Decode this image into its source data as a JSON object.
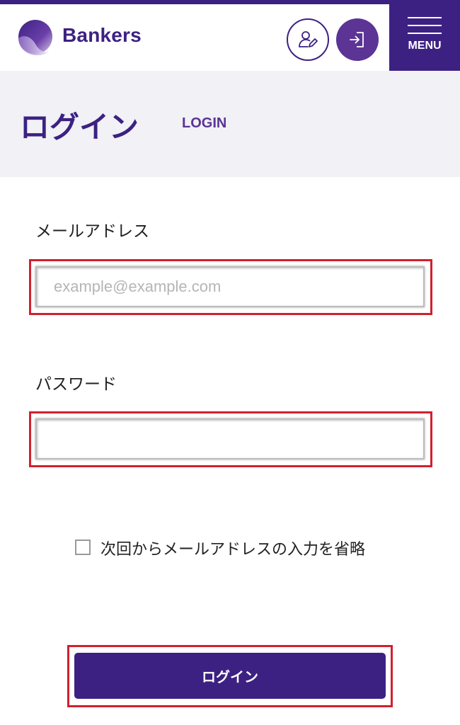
{
  "header": {
    "brand": "Bankers",
    "register_icon": "user-edit-icon",
    "login_icon": "sign-in-icon",
    "menu_label": "MENU"
  },
  "banner": {
    "title": "ログイン",
    "subtitle": "LOGIN"
  },
  "form": {
    "email_label": "メールアドレス",
    "email_placeholder": "example@example.com",
    "email_value": "",
    "password_label": "パスワード",
    "password_value": "",
    "remember_label": "次回からメールアドレスの入力を省略",
    "remember_checked": false,
    "submit_label": "ログイン"
  },
  "colors": {
    "brand": "#3c2183",
    "accent": "#5b3496",
    "highlight": "#d0202e",
    "banner_bg": "#f1f1f6"
  }
}
